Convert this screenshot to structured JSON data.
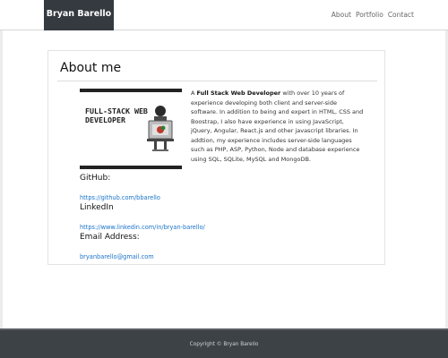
{
  "navbar": {
    "brand": "Bryan Barello",
    "links": [
      "About",
      "Portfolio",
      "Contact"
    ]
  },
  "about": {
    "title": "About me",
    "hero_image_text": [
      "FULL-STACK WEB",
      "DEVELOPER"
    ],
    "bio_intro": "A ",
    "bio_bold": "Full Stack Web Developer",
    "bio_rest": " with over 10 years of experience developing both client and server-side software. In addition to being and expert in HTML, CSS and Boostrap, I also have experience in using JavaScript, jQuery, Angular, React.js and other javascript libraries. In addtion, my experience includes server-side languages such as PHP, ASP, Python, Node and database experience using SQL, SQLite, MySQL and MongoDB.",
    "github_heading": "GitHub:",
    "github_link": "https://github.com/bbarello",
    "linkedin_heading": "LinkedIn",
    "linkedin_link": "https://www.linkedin.com/in/bryan-barello/",
    "email_heading": "Email Address:",
    "email_link": "bryanbarello@gmail.com"
  },
  "footer": {
    "copyright": "Copyright © Bryan Barello"
  }
}
